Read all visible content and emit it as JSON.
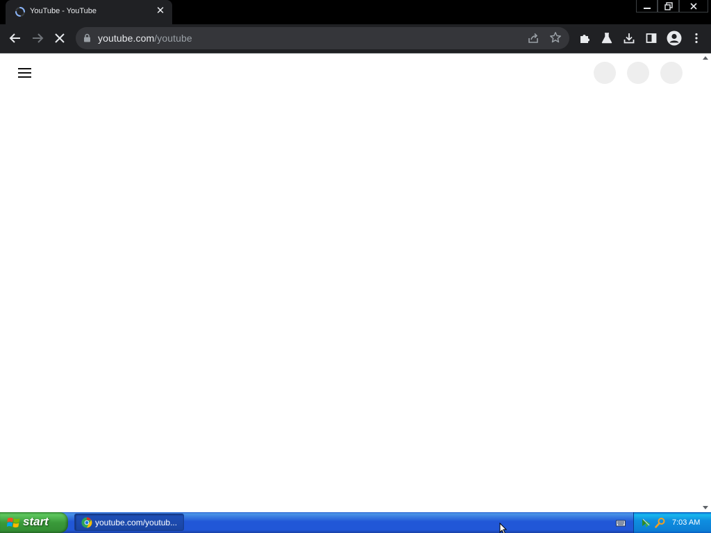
{
  "browser": {
    "tab": {
      "title": "YouTube - YouTube",
      "favicon": "loading-spinner-icon",
      "close_glyph": "✕"
    },
    "window_controls": [
      "minimize-icon",
      "restore-icon",
      "close-icon"
    ],
    "toolbar": {
      "back_icon": "back-arrow-icon",
      "forward_icon": "forward-arrow-icon",
      "stop_icon": "stop-loading-icon",
      "url_host": "youtube.com",
      "url_path": "/youtube",
      "right_icons": [
        "extensions-icon",
        "labs-flask-icon",
        "download-icon",
        "side-panel-icon",
        "profile-icon",
        "kebab-menu-icon"
      ]
    }
  },
  "page": {
    "state": "loading",
    "header_left": "hamburger-menu-icon",
    "skeleton_placeholders": 3
  },
  "taskbar": {
    "start_label": "start",
    "task_item_label": "youtube.com/youtub...",
    "clock": "7:03 AM"
  },
  "colors": {
    "toolbar_bg": "#202124",
    "omnibox_bg": "#35363a",
    "taskbar_blue": "#2157d7",
    "start_green": "#3a9a3a"
  }
}
